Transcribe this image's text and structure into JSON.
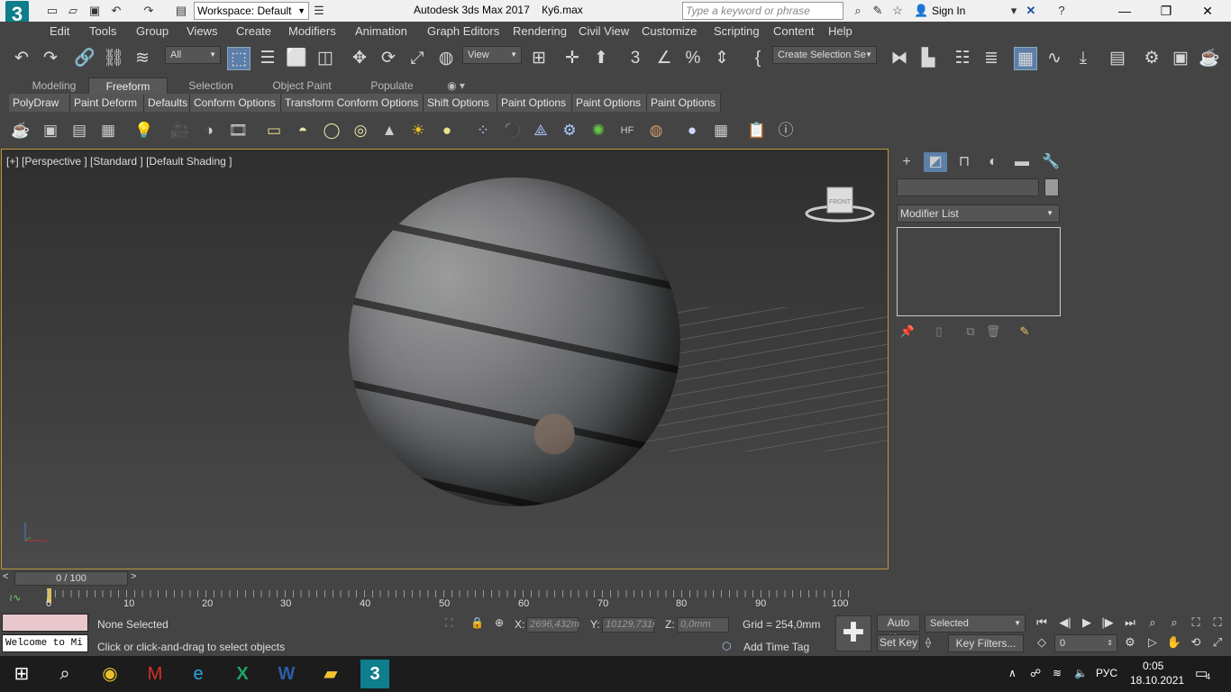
{
  "titlebar": {
    "app_title": "Autodesk 3ds Max 2017",
    "file_name": "Ку6.max",
    "workspace_label": "Workspace: Default",
    "search_placeholder": "Type a keyword or phrase",
    "signin_label": "Sign In"
  },
  "menu": [
    "Edit",
    "Tools",
    "Group",
    "Views",
    "Create",
    "Modifiers",
    "Animation",
    "Graph Editors",
    "Rendering",
    "Civil View",
    "Customize",
    "Scripting",
    "Content",
    "Help"
  ],
  "toolbar": {
    "filter_value": "All",
    "refcoord_value": "View",
    "selection_set_label": "Create Selection Se"
  },
  "ribbon_tabs": [
    "Modeling",
    "Freeform",
    "Selection",
    "Object Paint",
    "Populate"
  ],
  "ribbon_active_tab": "Freeform",
  "ribbon_buttons": [
    "PolyDraw",
    "Paint Deform",
    "Defaults",
    "Conform Options",
    "Transform Conform Options",
    "Shift Options",
    "Paint Options",
    "Paint Options",
    "Paint Options"
  ],
  "viewport": {
    "label": "[+] [Perspective ] [Standard ] [Default Shading ]",
    "viewcube_label": "FRONT"
  },
  "command_panel": {
    "modifier_list_label": "Modifier List"
  },
  "timeslider": {
    "frame_label": "0 / 100",
    "ticks": [
      "0",
      "10",
      "20",
      "30",
      "40",
      "50",
      "60",
      "70",
      "80",
      "90",
      "100"
    ]
  },
  "status": {
    "listener_text": "Welcome to Mi",
    "selection_text": "None Selected",
    "prompt_text": "Click or click-and-drag to select objects",
    "x_label": "X:",
    "x_value": "2696,432m",
    "y_label": "Y:",
    "y_value": "10129,731i",
    "z_label": "Z:",
    "z_value": "0,0mm",
    "grid_text": "Grid = 254,0mm",
    "add_time_tag": "Add Time Tag",
    "auto_key": "Auto Key",
    "set_key": "Set Key",
    "selected_value": "Selected",
    "key_filters": "Key Filters...",
    "frame_value": "0"
  },
  "taskbar": {
    "lang": "РУС",
    "time": "0:05",
    "date": "18.10.2021",
    "notifications": "4"
  },
  "colors": {
    "accent_blue": "#5d7fa9",
    "viewport_border": "#b99a3c",
    "logo": "#0e7d8c"
  }
}
